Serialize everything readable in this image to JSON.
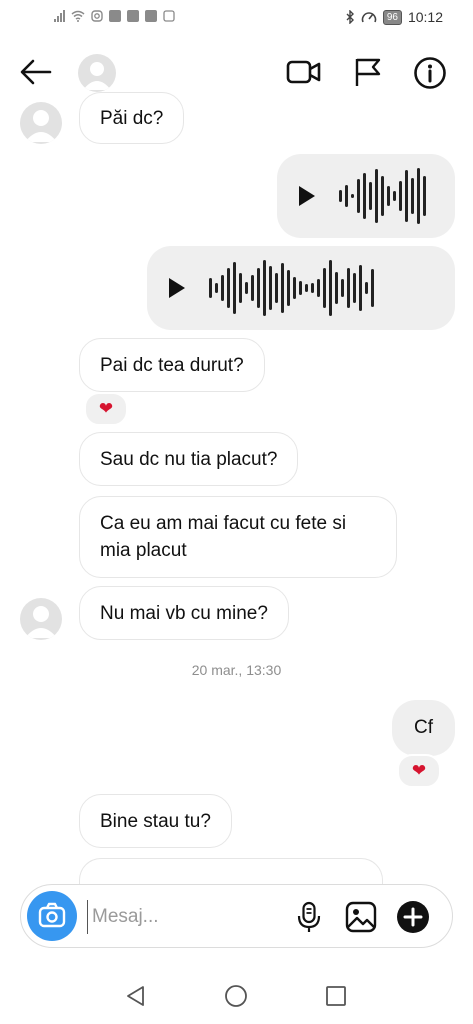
{
  "status_bar": {
    "time": "10:12",
    "battery": "96",
    "left_icons": [
      "signal-icon",
      "wifi-icon",
      "instagram-icon",
      "facebook-icon",
      "news-icon",
      "mail-icon",
      "r-icon"
    ],
    "right_icons": [
      "bluetooth-icon",
      "speed-icon"
    ]
  },
  "header": {
    "icons": [
      "back-arrow-icon",
      "avatar",
      "video-call-icon",
      "flag-icon",
      "info-icon"
    ]
  },
  "messages": [
    {
      "direction": "in",
      "type": "text",
      "text": "Păi dc?"
    },
    {
      "direction": "out",
      "type": "voice"
    },
    {
      "direction": "out",
      "type": "voice"
    },
    {
      "direction": "in",
      "type": "text",
      "text": "Pai dc tea durut?",
      "reaction": "heart"
    },
    {
      "direction": "in",
      "type": "text",
      "text": "Sau dc nu tia placut?"
    },
    {
      "direction": "in",
      "type": "text",
      "text": "Ca eu am mai facut cu fete si mia placut"
    },
    {
      "direction": "in",
      "type": "text",
      "text": "Nu mai vb cu mine?"
    },
    {
      "direction": "out",
      "type": "text",
      "text": "Cf",
      "reaction": "heart"
    },
    {
      "direction": "in",
      "type": "text",
      "text": "Bine stau tu?"
    }
  ],
  "timestamp": "20 mar., 13:30",
  "reaction_emoji": "❤",
  "composer": {
    "placeholder": "Mesaj...",
    "value": "",
    "icons": [
      "camera-icon",
      "microphone-icon",
      "image-icon",
      "plus-icon"
    ]
  },
  "nav_bar": {
    "icons": [
      "nav-back-icon",
      "nav-home-icon",
      "nav-recent-icon"
    ]
  },
  "colors": {
    "accent": "#3797f0",
    "reaction_heart": "#d6142f",
    "bubble_out": "#efefef",
    "text": "#111111"
  }
}
